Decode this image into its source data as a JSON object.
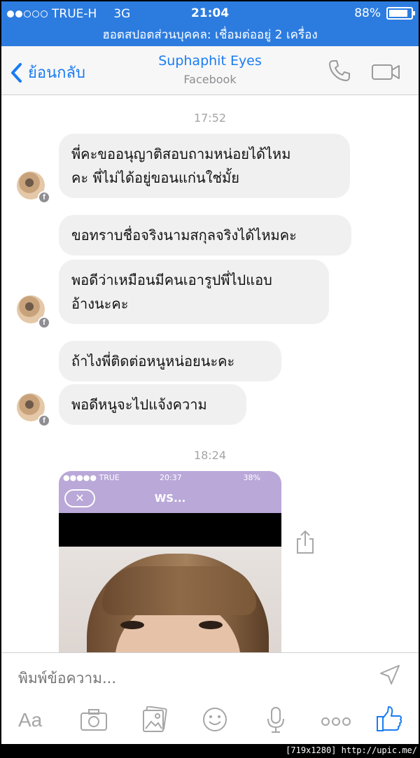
{
  "status_bar": {
    "carrier": "TRUE-H",
    "network": "3G",
    "time": "21:04",
    "battery": "88%"
  },
  "hotspot_banner": "ฮอตสปอตส่วนบุคคล: เชื่อมต่ออยู่ 2 เครื่อง",
  "nav": {
    "back_label": "ย้อนกลับ",
    "contact_name": "Suphaphit Eyes",
    "contact_source": "Facebook"
  },
  "messages": {
    "time_1": "17:52",
    "msg_1_line1": "พี่คะขออนุญาติสอบถามหน่อยได้ไหม",
    "msg_1_line2": "คะ พี่ไม่ได้อยู่ขอนแก่นใช่มั้ย",
    "msg_2": "ขอทราบชื่อจริงนามสกุลจริงได้ไหมคะ",
    "msg_3_line1": "พอดีว่าเหมือนมีคนเอารูปพี่ไปแอบ",
    "msg_3_line2": "อ้างนะคะ",
    "msg_4": "ถ้าไงพี่ติดต่อหนูหน่อยนะคะ",
    "msg_5": "พอดีหนูจะไปแจ้งความ",
    "time_2": "18:24"
  },
  "shared_screenshot": {
    "carrier": "●●●●● TRUE",
    "time": "20:37",
    "battery": "38%",
    "title": "WS..."
  },
  "composer": {
    "placeholder": "พิมพ์ข้อความ...",
    "aa_label": "Aa"
  },
  "footer": "[719x1280] http://upic.me/",
  "colors": {
    "accent_blue": "#1a7cf2",
    "status_bar_blue": "#2c7ce0",
    "bubble_gray": "#f1f0f0"
  }
}
